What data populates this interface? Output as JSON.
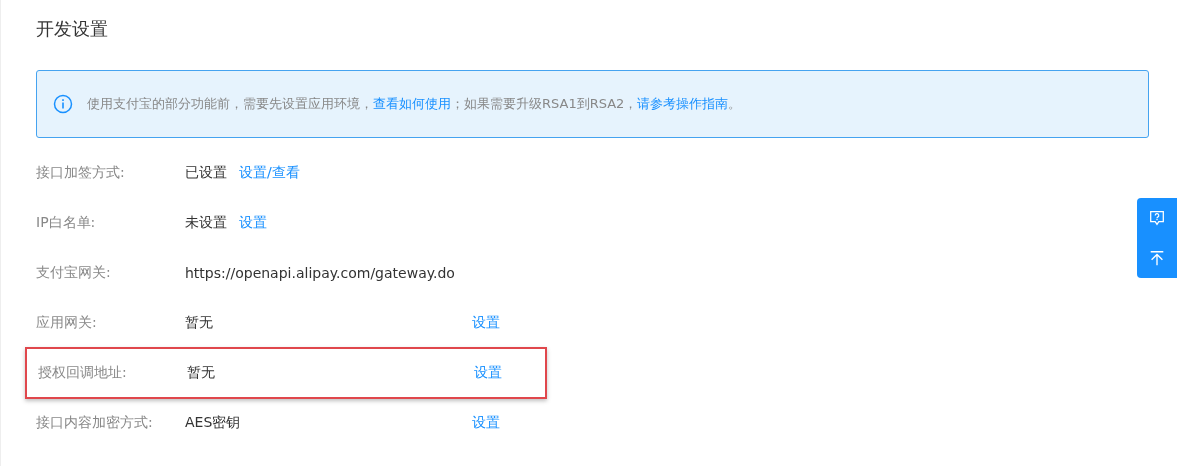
{
  "title": "开发设置",
  "notice": {
    "parts": [
      {
        "kind": "text",
        "text": "使用支付宝的部分功能前，需要先设置应用环境，"
      },
      {
        "kind": "link",
        "text": "查看如何使用"
      },
      {
        "kind": "text",
        "text": "；如果需要升级RSA1到RSA2，"
      },
      {
        "kind": "link",
        "text": "请参考操作指南"
      },
      {
        "kind": "text",
        "text": "。"
      }
    ]
  },
  "rows": [
    {
      "label": "接口加签方式:",
      "value": "已设置",
      "link": "设置/查看",
      "kind": "inline",
      "highlighted": false
    },
    {
      "label": "IP白名单:",
      "value": "未设置",
      "link": "设置",
      "kind": "inline",
      "highlighted": false
    },
    {
      "label": "支付宝网关:",
      "value": "https://openapi.alipay.com/gateway.do",
      "kind": "plain",
      "highlighted": false
    },
    {
      "label": "应用网关:",
      "value": "暂无",
      "link": "设置",
      "kind": "column",
      "highlighted": false
    },
    {
      "label": "授权回调地址:",
      "value": "暂无",
      "link": "设置",
      "kind": "column",
      "highlighted": true
    },
    {
      "label": "接口内容加密方式:",
      "value": "AES密钥",
      "link": "设置",
      "kind": "column",
      "highlighted": false
    }
  ]
}
